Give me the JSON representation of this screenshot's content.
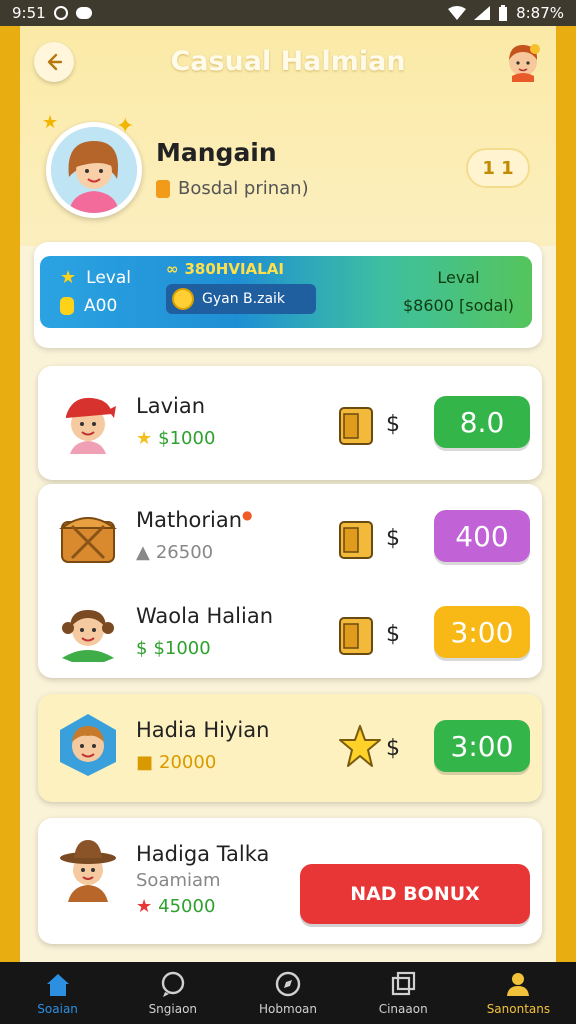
{
  "status_bar": {
    "time": "9:51",
    "battery": "8:87%"
  },
  "header": {
    "back_icon": "back-arrow-icon",
    "title": "Casual Halmian",
    "profile_name": "Mangain",
    "profile_sub": "Bosdal prinan)",
    "pill_count": "1 1"
  },
  "level_card": {
    "left_label": "Leval",
    "left_value": "A00",
    "mid_title": "380HVIALAI",
    "mid_button": "Gyan B.zaik",
    "right_label": "Leval",
    "right_value": "$8600 [sodal)"
  },
  "items": [
    {
      "name": "Lavian",
      "sub": "$1000",
      "dollar": "$",
      "price": "8.0"
    },
    {
      "name": "Mathorian",
      "sub": "26500",
      "dollar": "$",
      "price": "400"
    },
    {
      "name": "Waola Halian",
      "sub": "$1000",
      "dollar": "$",
      "price": "3:00"
    },
    {
      "name": "Hadia Hiyian",
      "sub": "20000",
      "dollar": "$",
      "price": "3:00"
    },
    {
      "name": "Hadiga Talka",
      "sub2": "Soamiam",
      "sub": "45000",
      "button": "NAD BONUX"
    }
  ],
  "nav": [
    {
      "label": "Soaian"
    },
    {
      "label": "Sngiaon"
    },
    {
      "label": "Hobmoan"
    },
    {
      "label": "Cinaaon"
    },
    {
      "label": "Sanontans"
    }
  ],
  "colors": {
    "accent_green": "#34b54a",
    "accent_purple": "#c162d6",
    "accent_orange": "#f8b916",
    "accent_red": "#e83535",
    "frame_gold": "#e8ad10"
  }
}
